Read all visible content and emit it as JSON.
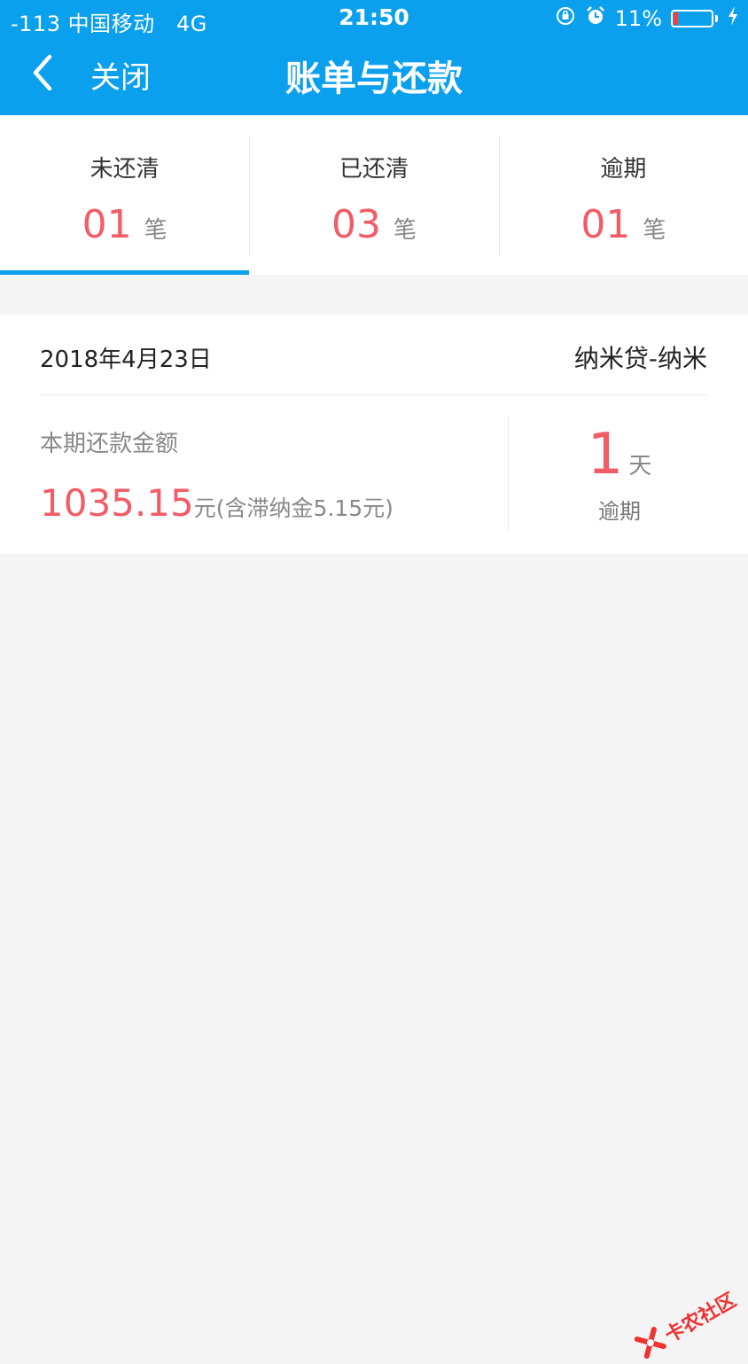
{
  "status_bar": {
    "signal_carrier": "-113 中国移动",
    "network": "4G",
    "time": "21:50",
    "battery_text": "11%",
    "battery_level": 0.11,
    "icons": [
      "rotation-lock-icon",
      "alarm-icon",
      "battery-icon",
      "charging-icon"
    ]
  },
  "nav": {
    "back_label": "关闭",
    "title": "账单与还款"
  },
  "tabs": [
    {
      "label": "未还清",
      "count": "01",
      "unit": "笔",
      "active": true
    },
    {
      "label": "已还清",
      "count": "03",
      "unit": "笔",
      "active": false
    },
    {
      "label": "逾期",
      "count": "01",
      "unit": "笔",
      "active": false
    }
  ],
  "bill": {
    "date": "2018年4月23日",
    "product": "纳米贷-纳米",
    "amount_label": "本期还款金额",
    "amount": "1035.15",
    "amount_unit": "元",
    "amount_note": "(含滞纳金5.15元)",
    "overdue_days": "1",
    "overdue_unit": "天",
    "overdue_label": "逾期"
  },
  "watermark": {
    "text": "卡农社区"
  },
  "colors": {
    "brand_blue": "#0aa0ee",
    "accent_red": "#f25c66",
    "background": "#f4f4f4"
  }
}
